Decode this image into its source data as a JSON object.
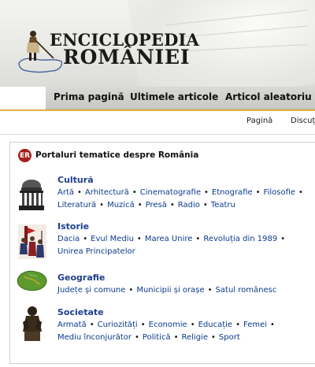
{
  "logo": {
    "line1": "ENCICLOPEDIA",
    "line2": "ROMÂNIEI"
  },
  "topnav": [
    "Prima pagină",
    "Ultimele articole",
    "Articol aleatoriu"
  ],
  "tabs": [
    "Pagină",
    "Discuț"
  ],
  "portal": {
    "badge": "ER",
    "title": "Portaluri tematice despre România",
    "categories": [
      {
        "title": "Cultură",
        "icon": "athenaeum-icon",
        "rows": [
          [
            "Artă",
            "Arhitectură",
            "Cinematografie",
            "Etnografie",
            "Filosofie"
          ],
          [
            "Literatură",
            "Muzică",
            "Presă",
            "Radio",
            "Teatru"
          ]
        ]
      },
      {
        "title": "Istorie",
        "icon": "soldiers-icon",
        "rows": [
          [
            "Dacia",
            "Evul Mediu",
            "Marea Unire",
            "Revoluția din 1989"
          ],
          [
            "Unirea Principatelor"
          ]
        ]
      },
      {
        "title": "Geografie",
        "icon": "romania-map-icon",
        "rows": [
          [
            "Județe și comune",
            "Municipii și orașe",
            "Satul românesc"
          ]
        ]
      },
      {
        "title": "Societate",
        "icon": "statue-icon",
        "rows": [
          [
            "Armată",
            "Curiozități",
            "Economie",
            "Educație",
            "Femei"
          ],
          [
            "Mediu înconjurător",
            "Politică",
            "Religie",
            "Sport"
          ]
        ]
      }
    ]
  },
  "colors": {
    "accent": "#e2b33f",
    "link": "#0b3a8d",
    "badge": "#a8201a"
  }
}
